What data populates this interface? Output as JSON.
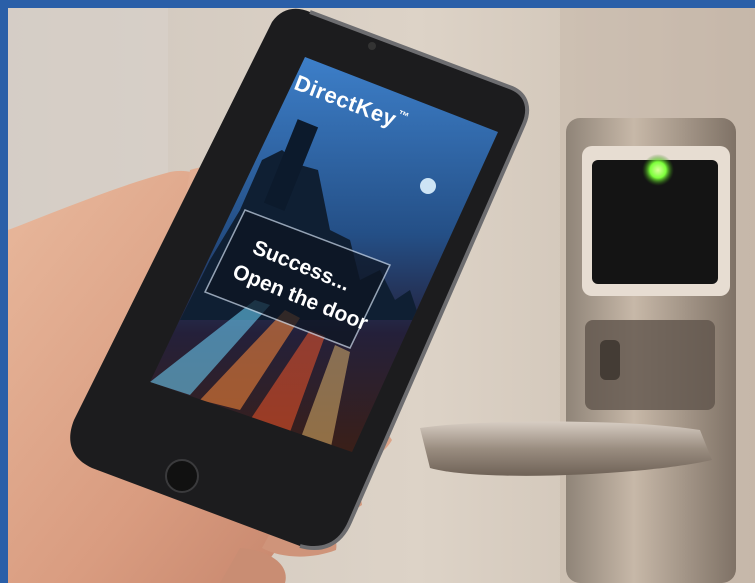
{
  "photo": {
    "subject": "hand holding smartphone in front of hotel door lock",
    "frame_color": "#2a5fa8",
    "lock_indicator_color": "#7cff3a"
  },
  "app_screen": {
    "brand": "DirectKey",
    "trademark": "™",
    "status_line_1": "Success...",
    "status_line_2": "Open the door"
  }
}
